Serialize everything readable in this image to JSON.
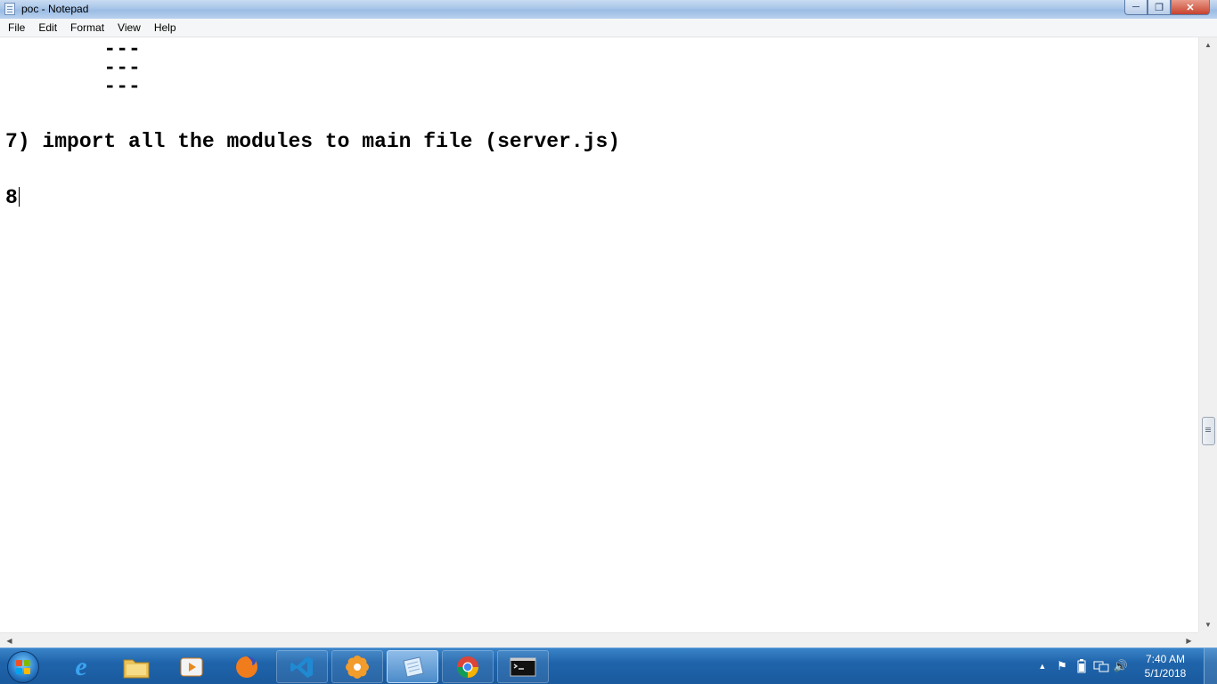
{
  "window": {
    "title": "poc - Notepad"
  },
  "menu": [
    {
      "label": "File"
    },
    {
      "label": "Edit"
    },
    {
      "label": "Format"
    },
    {
      "label": "View"
    },
    {
      "label": "Help"
    }
  ],
  "editor": {
    "lines": [
      "        ---",
      "        ---",
      "        ---",
      "7) import all the modules to main file (server.js)",
      "8"
    ]
  },
  "taskbar": {
    "apps": [
      {
        "name": "internet-explorer-icon"
      },
      {
        "name": "file-explorer-icon"
      },
      {
        "name": "media-player-icon"
      },
      {
        "name": "firefox-icon"
      },
      {
        "name": "visual-studio-code-icon"
      },
      {
        "name": "flower-app-icon"
      },
      {
        "name": "notepad-icon"
      },
      {
        "name": "chrome-icon"
      },
      {
        "name": "command-prompt-icon"
      }
    ],
    "clock": {
      "time": "7:40 AM",
      "date": "5/1/2018"
    }
  },
  "colors": {
    "taskbar": "#1f64ab",
    "titlebar": "#a8c5e8",
    "close_button": "#c6432e"
  }
}
